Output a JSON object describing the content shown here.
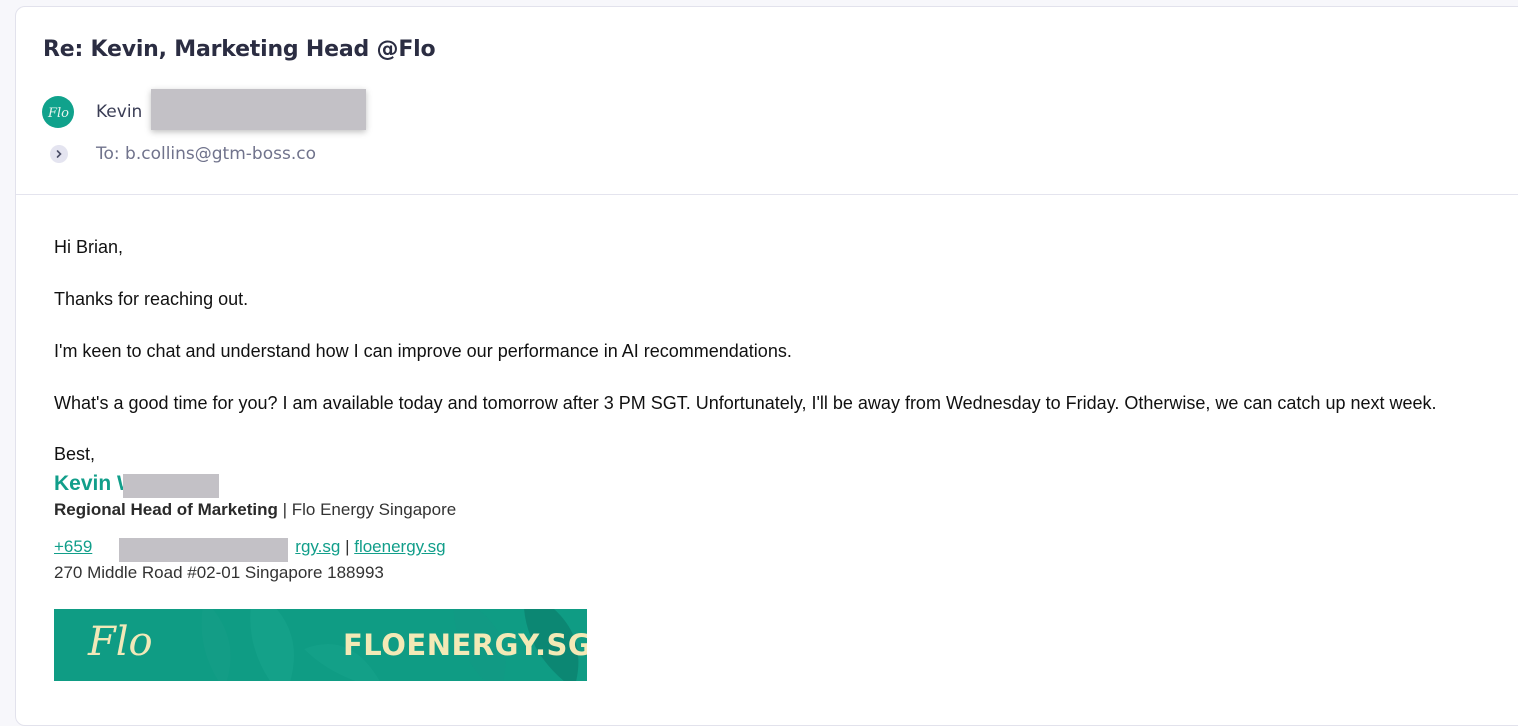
{
  "email": {
    "subject": "Re: Kevin, Marketing Head @Flo",
    "sender": {
      "name": "Kevin",
      "avatar_text": "Flo"
    },
    "to_line": "To: b.collins@gtm-boss.co"
  },
  "message": {
    "greeting": "Hi Brian,",
    "paragraphs": [
      "Thanks for reaching out.",
      "I'm keen to chat and understand how I can improve our performance in AI recommendations.",
      "What's a good time for you? I am available today and tomorrow after 3 PM SGT. Unfortunately, I'll be away from Wednesday to Friday. Otherwise, we can catch up next week."
    ],
    "closing": "Best,"
  },
  "signature": {
    "name": "Kevin W",
    "title": "Regional Head of Marketing",
    "separator": " | ",
    "company": "Flo Energy Singapore",
    "phone_fragment": "+659",
    "email_fragment": "rgy.sg",
    "contact_separator": " | ",
    "website": "floenergy.sg",
    "address": "270 Middle Road #02-01 Singapore 188993",
    "banner": {
      "logo": "Flo",
      "url": "FLOENERGY.SG"
    }
  },
  "icons": {
    "expand": "chevron-right-icon",
    "avatar": "flo-logo-icon"
  },
  "colors": {
    "brand": "#119e8a",
    "banner": "#0f9c84",
    "banner_text": "#f3e9b6",
    "subject": "#2b2d42"
  }
}
